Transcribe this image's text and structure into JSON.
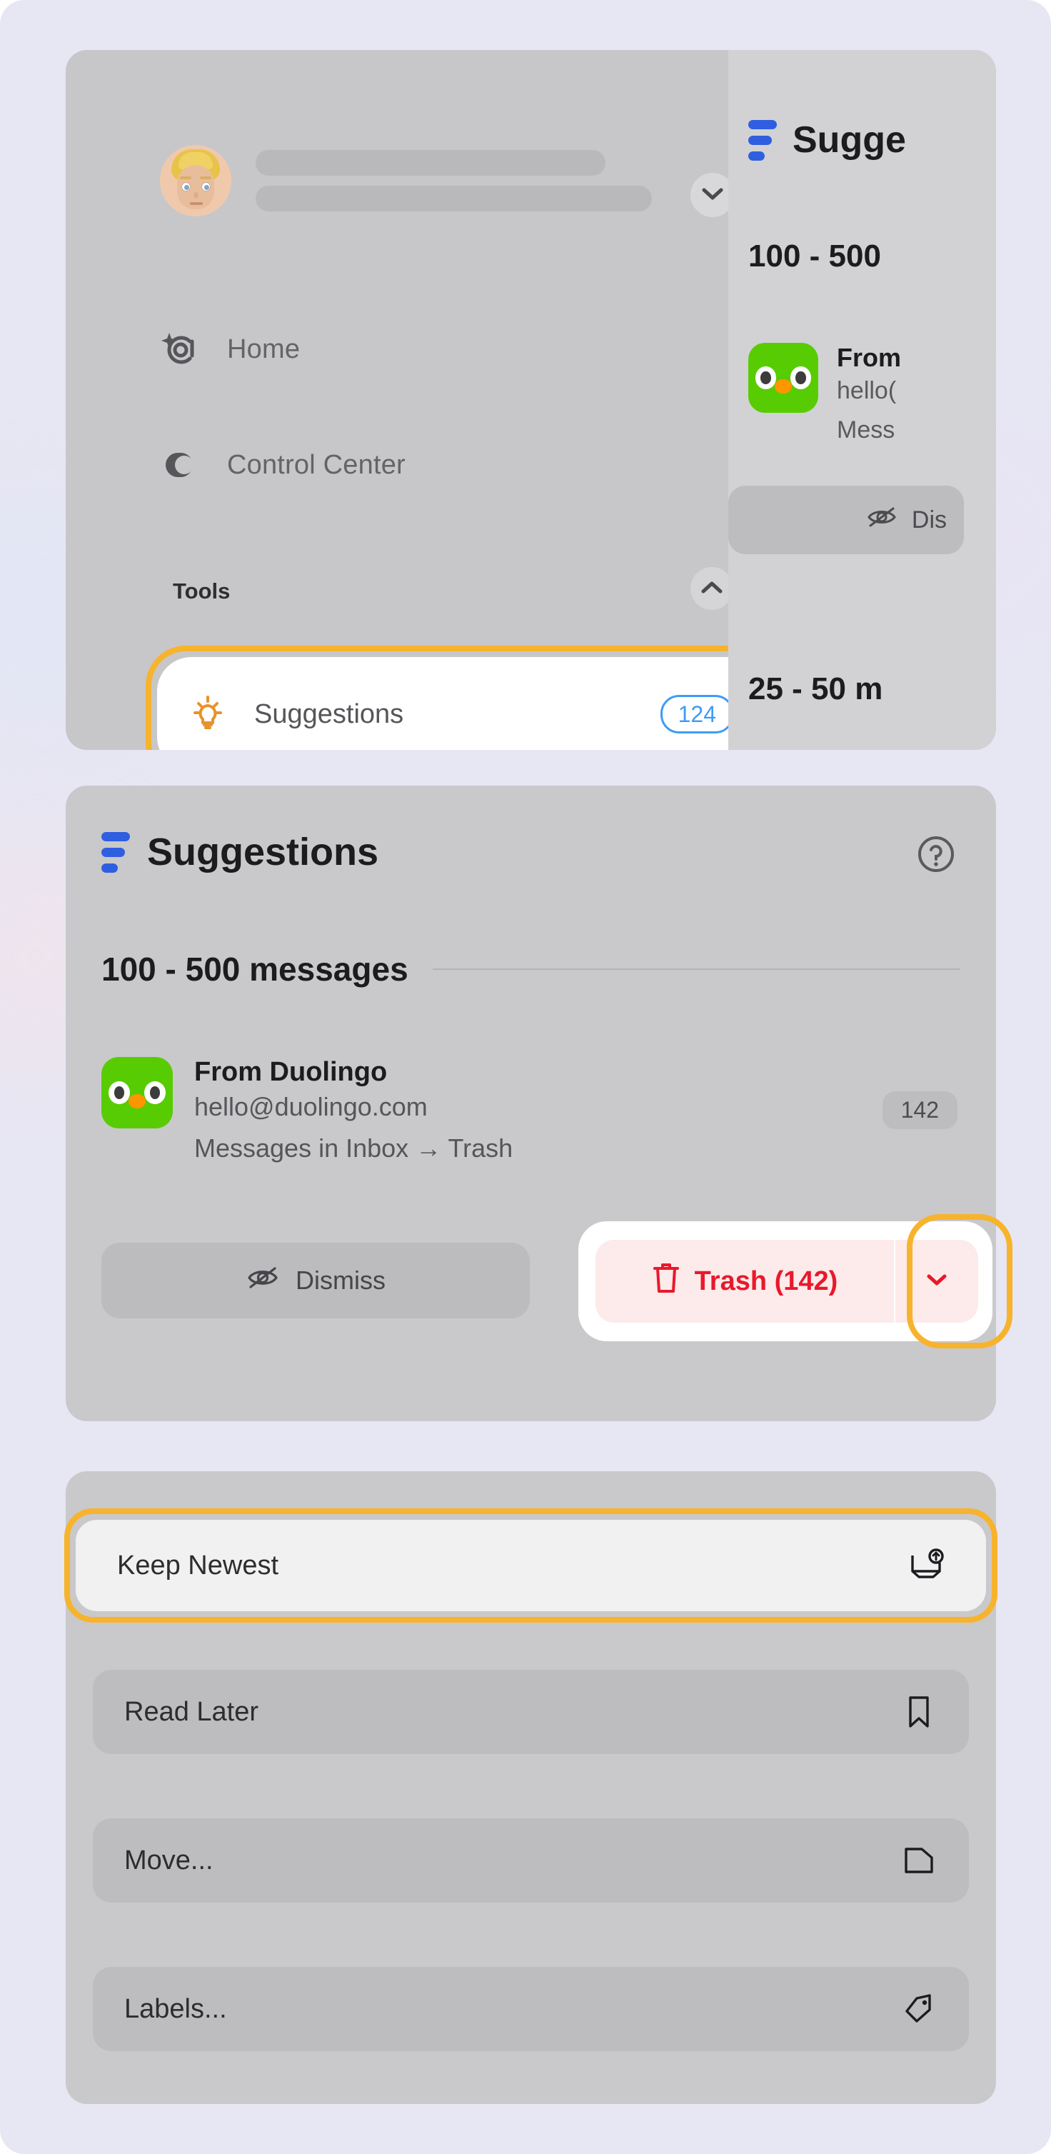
{
  "theme": {
    "background": "#e7e6f3",
    "panel": "#c9c9cb",
    "highlight_ring": "#f7b32c",
    "accent_blue": "#2f5fe0",
    "badge_blue": "#3e9cf5",
    "danger_red": "#e8192c",
    "duolingo_green": "#58cc02"
  },
  "sidebar": {
    "account": {
      "avatar_icon": "memoji-avatar",
      "name_placeholder": "",
      "email_placeholder": "",
      "expand_icon": "chevron-down-icon"
    },
    "nav": [
      {
        "label": "Home",
        "icon": "sparkle-at-icon"
      },
      {
        "label": "Control Center",
        "icon": "contrast-circle-icon"
      }
    ],
    "tools_section": {
      "title": "Tools",
      "collapse_icon": "chevron-up-icon"
    },
    "suggestions_item": {
      "label": "Suggestions",
      "icon": "lightbulb-icon",
      "count": "124",
      "highlighted": true
    }
  },
  "clipped_panel": {
    "title": "Sugge",
    "list_icon": "bars-list-icon",
    "group": "100 - 500",
    "sender_name": "From",
    "sender_email": "hello(",
    "move_text": "Mess",
    "dismiss_label": "Dis",
    "dismiss_icon": "eye-slash-icon",
    "next_group": "25 - 50 m"
  },
  "suggestions_panel": {
    "title": "Suggestions",
    "list_icon": "bars-list-icon",
    "help_icon": "question-circle-icon",
    "group_header": "100 - 500 messages",
    "sender": {
      "app_icon": "duolingo-icon",
      "name": "From Duolingo",
      "email": "hello@duolingo.com",
      "move_text": "Messages in Inbox → Trash",
      "count": "142"
    },
    "actions": {
      "dismiss_label": "Dismiss",
      "dismiss_icon": "eye-slash-icon",
      "trash_label": "Trash (142)",
      "trash_icon": "trash-icon",
      "trash_more_icon": "chevron-down-icon",
      "trash_more_highlighted": true
    }
  },
  "action_menu": {
    "items": [
      {
        "label": "Keep Newest",
        "icon": "tray-arrow-up-icon",
        "highlighted": true
      },
      {
        "label": "Read Later",
        "icon": "bookmark-icon",
        "highlighted": false
      },
      {
        "label": "Move...",
        "icon": "folder-icon",
        "highlighted": false
      },
      {
        "label": "Labels...",
        "icon": "tag-icon",
        "highlighted": false
      }
    ]
  }
}
